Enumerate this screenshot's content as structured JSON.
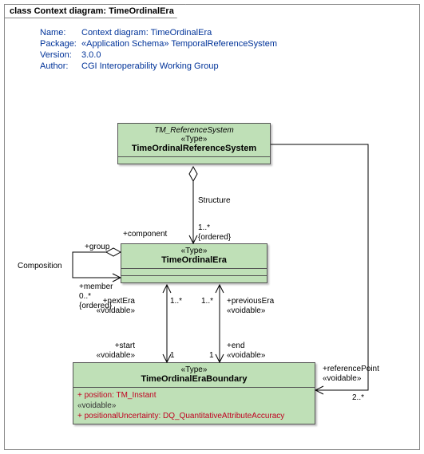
{
  "frame": {
    "keyword": "class",
    "title": "Context diagram: TimeOrdinalEra"
  },
  "meta": {
    "name_label": "Name:",
    "name": "Context diagram: TimeOrdinalEra",
    "package_label": "Package:",
    "package": "«Application Schema» TemporalReferenceSystem",
    "version_label": "Version:",
    "version": "3.0.0",
    "author_label": "Author:",
    "author": "CGI Interoperability Working Group"
  },
  "classes": {
    "refsys": {
      "parent": "TM_ReferenceSystem",
      "stereo": "«Type»",
      "name": "TimeOrdinalReferenceSystem"
    },
    "era": {
      "stereo": "«Type»",
      "name": "TimeOrdinalEra"
    },
    "boundary": {
      "stereo": "«Type»",
      "name": "TimeOrdinalEraBoundary",
      "attr1": "+   position:  TM_Instant",
      "voidable": "«voidable»",
      "attr2": "+   positionalUncertainty:  DQ_QuantitativeAttributeAccuracy"
    }
  },
  "labels": {
    "structure": "Structure",
    "component": "+component",
    "mult_1_star": "1..*",
    "ordered": "{ordered}",
    "group": "+group",
    "composition": "Composition",
    "member": "+member",
    "mult_0_star": "0..*",
    "nextEra": "+nextEra",
    "voidable": "«voidable»",
    "mult_1": "1",
    "previousEra": "+previousEra",
    "start": "+start",
    "end": "+end",
    "referencePoint": "+referencePoint",
    "mult_2_star": "2..*"
  },
  "chart_data": {
    "type": "uml-class-diagram",
    "title": "Context diagram: TimeOrdinalEra",
    "classes": [
      {
        "id": "TimeOrdinalReferenceSystem",
        "stereotype": "Type",
        "parent": "TM_ReferenceSystem"
      },
      {
        "id": "TimeOrdinalEra",
        "stereotype": "Type"
      },
      {
        "id": "TimeOrdinalEraBoundary",
        "stereotype": "Type",
        "attributes": [
          {
            "name": "position",
            "type": "TM_Instant",
            "visibility": "+"
          },
          {
            "name": "positionalUncertainty",
            "type": "DQ_QuantitativeAttributeAccuracy",
            "visibility": "+",
            "tag": "voidable"
          }
        ]
      }
    ],
    "associations": [
      {
        "name": "Structure",
        "from": "TimeOrdinalReferenceSystem",
        "to": "TimeOrdinalEra",
        "toRole": "component",
        "toMult": "1..*",
        "toOrdered": true,
        "aggregation": "shared"
      },
      {
        "name": "Composition",
        "from": "TimeOrdinalEra",
        "to": "TimeOrdinalEra",
        "fromRole": "group",
        "toRole": "member",
        "toMult": "0..*",
        "toOrdered": true,
        "aggregation": "shared"
      },
      {
        "from": "TimeOrdinalEra",
        "to": "TimeOrdinalEraBoundary",
        "fromRole": "nextEra",
        "fromMult": "1..*",
        "fromTag": "voidable",
        "toRole": "start",
        "toMult": "1",
        "toTag": "voidable"
      },
      {
        "from": "TimeOrdinalEra",
        "to": "TimeOrdinalEraBoundary",
        "fromRole": "previousEra",
        "fromMult": "1..*",
        "fromTag": "voidable",
        "toRole": "end",
        "toMult": "1",
        "toTag": "voidable"
      },
      {
        "from": "TimeOrdinalReferenceSystem",
        "to": "TimeOrdinalEraBoundary",
        "toRole": "referencePoint",
        "toMult": "2..*",
        "toTag": "voidable"
      }
    ]
  }
}
